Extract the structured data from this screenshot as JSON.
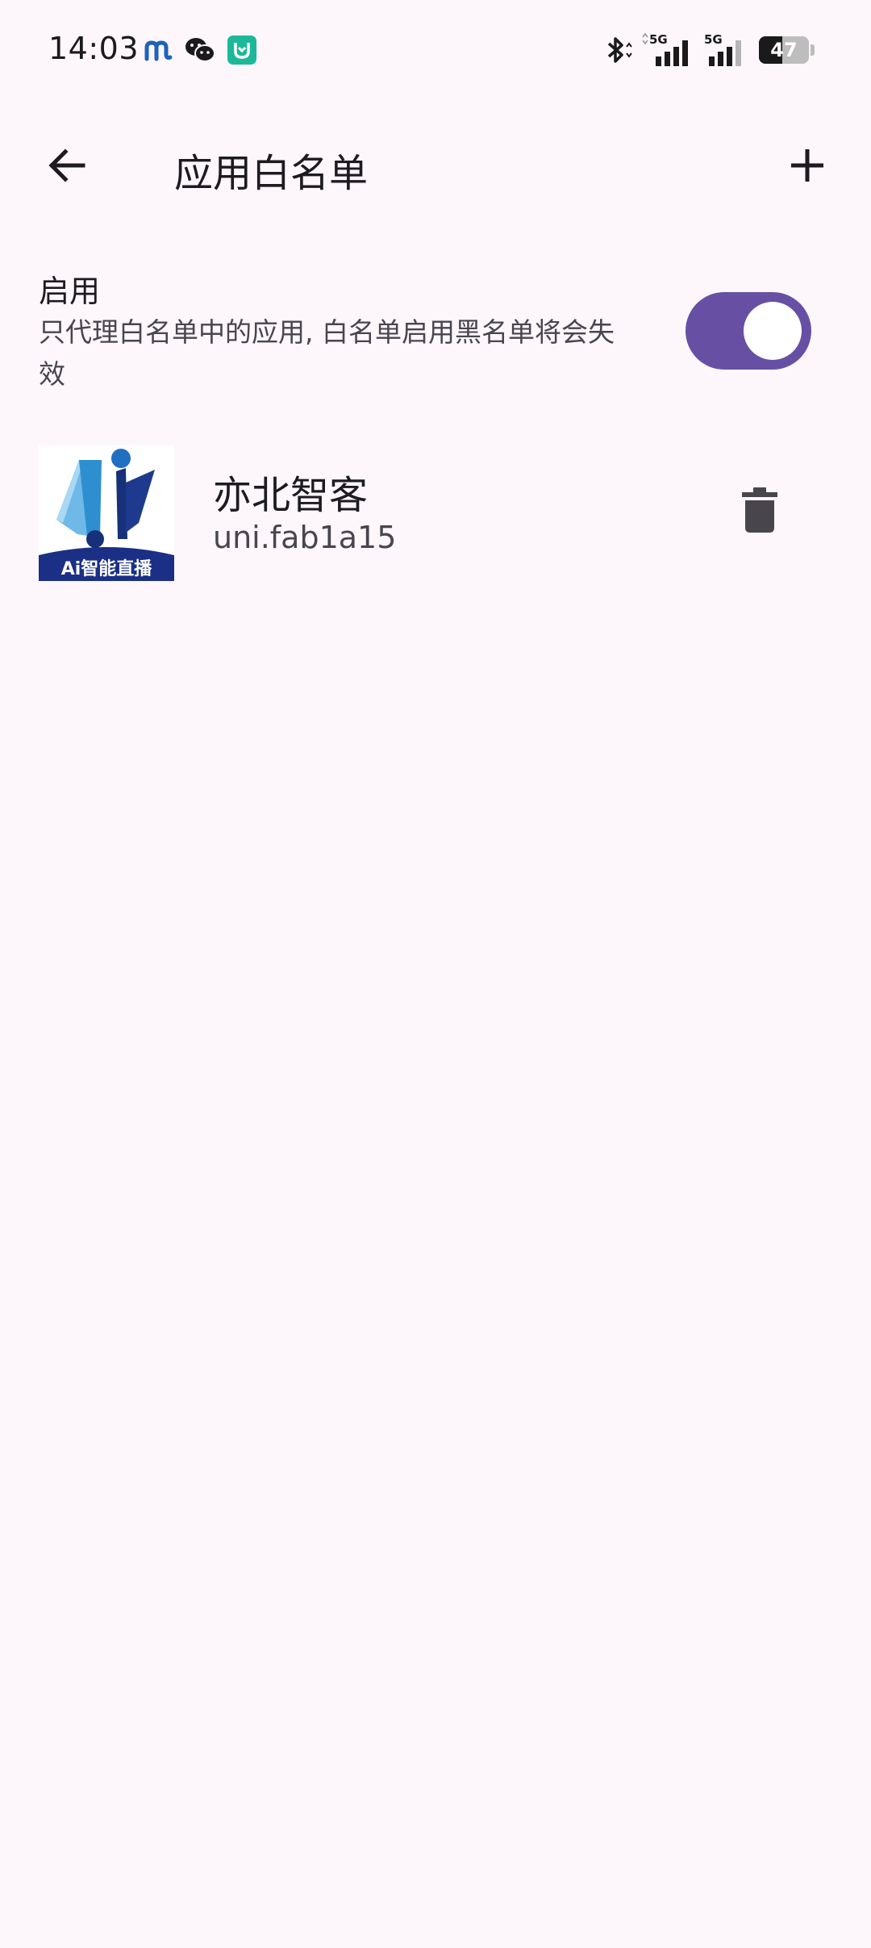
{
  "status_bar": {
    "time": "14:03",
    "battery_level": "47",
    "battery_fraction": 0.47,
    "signal_label_1": "5G",
    "signal_label_2": "5G",
    "left_icons": [
      "m-app-icon",
      "wechat-icon",
      "mi-home-icon"
    ],
    "right_icons": [
      "bluetooth-icon",
      "signal-5g-icon",
      "signal-5g-icon",
      "battery-icon"
    ]
  },
  "app_bar": {
    "title": "应用白名单",
    "back_icon": "arrow-back-icon",
    "add_icon": "plus-icon"
  },
  "enable_setting": {
    "title": "启用",
    "description": "只代理白名单中的应用, 白名单启用黑名单将会失效",
    "enabled": true
  },
  "apps": [
    {
      "name": "亦北智客",
      "package": "uni.fab1a15",
      "icon_caption": "Ai智能直播",
      "delete_icon": "trash-icon"
    }
  ],
  "colors": {
    "background": "#fdf7fc",
    "accent": "#6750a4",
    "primary_text": "#1d1b20",
    "secondary_text": "#49454f",
    "icon_dark": "#48464c"
  }
}
